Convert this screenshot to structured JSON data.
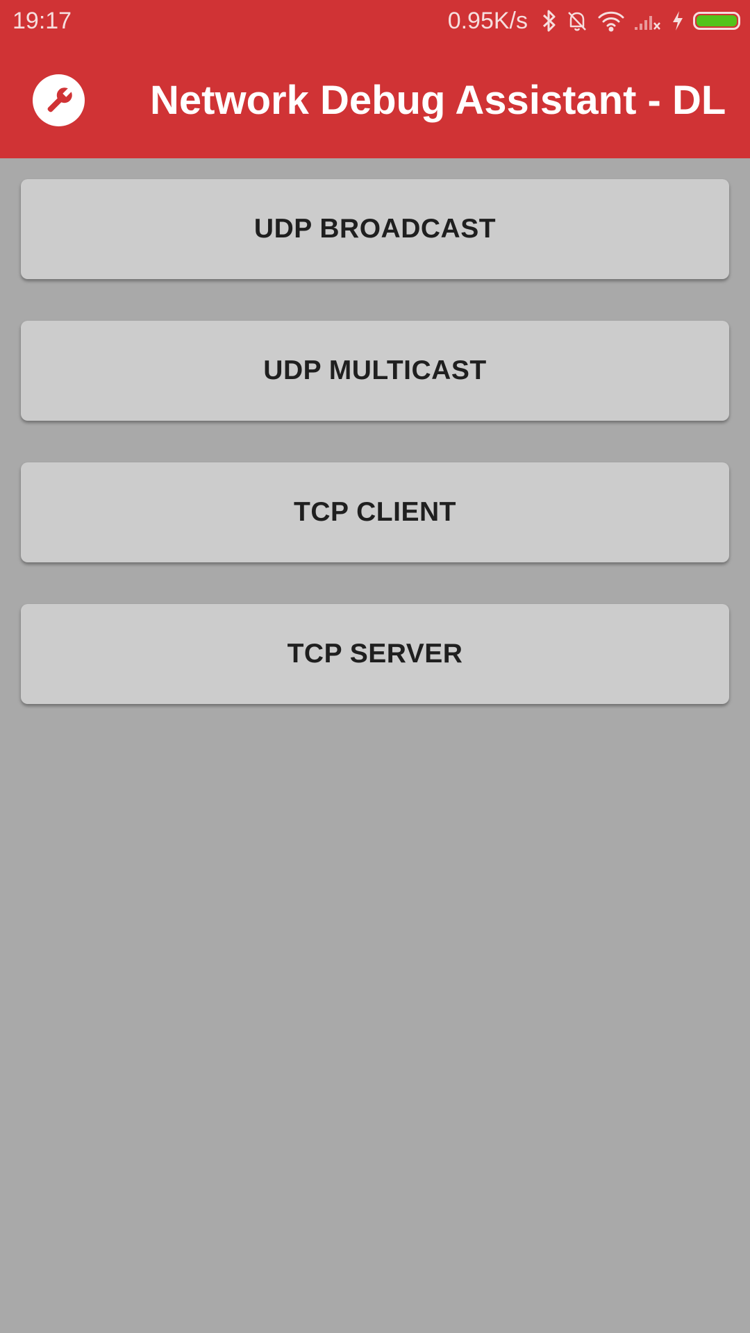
{
  "status_bar": {
    "time": "19:17",
    "net_speed": "0.95K/s",
    "icons": [
      "bluetooth-icon",
      "notifications-off-icon",
      "wifi-icon",
      "cellular-no-signal-icon",
      "charging-icon",
      "battery-icon"
    ],
    "battery_color": "#53c31b"
  },
  "app_bar": {
    "title": "Network Debug Assistant - DL",
    "icon": "wrench-icon",
    "color": "#d03335"
  },
  "menu": {
    "buttons": [
      {
        "label": "UDP BROADCAST"
      },
      {
        "label": "UDP MULTICAST"
      },
      {
        "label": "TCP CLIENT"
      },
      {
        "label": "TCP SERVER"
      }
    ]
  }
}
